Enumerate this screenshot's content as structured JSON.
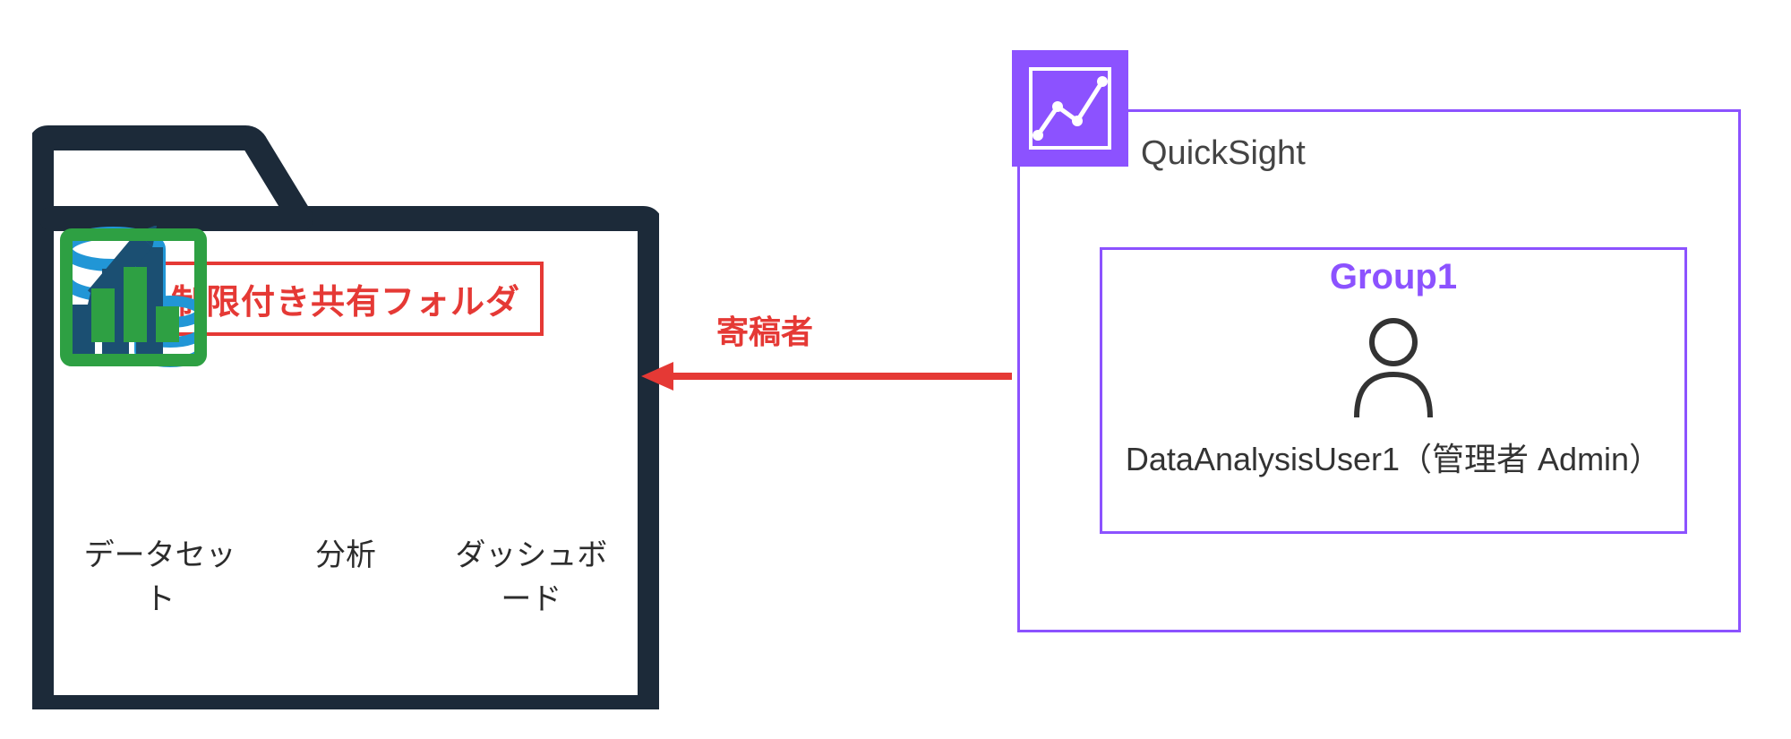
{
  "folder": {
    "title": "制限付き共有フォルダ",
    "items": {
      "dataset_label": "データセット",
      "analysis_label": "分析",
      "dashboard_label": "ダッシュボード"
    }
  },
  "relation": {
    "role_label": "寄稿者"
  },
  "quicksight": {
    "service_label": "QuickSight",
    "group": {
      "title": "Group1",
      "user_label": "DataAnalysisUser1（管理者 Admin）"
    }
  },
  "colors": {
    "folder_stroke": "#1c2a39",
    "accent_red": "#e53935",
    "quicksight_purple": "#8c52ff",
    "dataset_blue": "#2196d6",
    "analysis_navy": "#1b4f72",
    "dashboard_green": "#2ea043"
  }
}
